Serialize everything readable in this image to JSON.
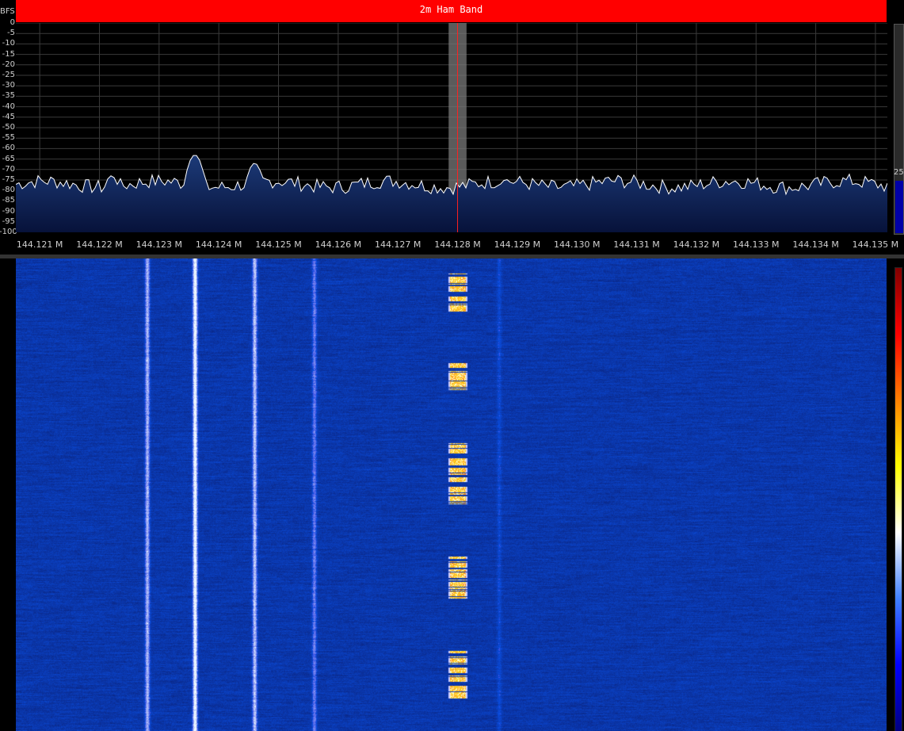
{
  "band": {
    "title": "2m Ham Band"
  },
  "spectrum": {
    "unit_label": "BFS",
    "db_ticks": [
      "0",
      "-5",
      "-10",
      "-15",
      "-20",
      "-25",
      "-30",
      "-35",
      "-40",
      "-45",
      "-50",
      "-55",
      "-60",
      "-65",
      "-70",
      "-75",
      "-80",
      "-85",
      "-90",
      "-95",
      "-100"
    ],
    "freq_ticks": [
      {
        "label": "144.121 M",
        "mhz": 144.121
      },
      {
        "label": "144.122 M",
        "mhz": 144.122
      },
      {
        "label": "144.123 M",
        "mhz": 144.123
      },
      {
        "label": "144.124 M",
        "mhz": 144.124
      },
      {
        "label": "144.125 M",
        "mhz": 144.125
      },
      {
        "label": "144.126 M",
        "mhz": 144.126
      },
      {
        "label": "144.127 M",
        "mhz": 144.127
      },
      {
        "label": "144.128 M",
        "mhz": 144.128
      },
      {
        "label": "144.129 M",
        "mhz": 144.129
      },
      {
        "label": "144.130 M",
        "mhz": 144.13
      },
      {
        "label": "144.131 M",
        "mhz": 144.131
      },
      {
        "label": "144.132 M",
        "mhz": 144.132
      },
      {
        "label": "144.133 M",
        "mhz": 144.133
      },
      {
        "label": "144.134 M",
        "mhz": 144.134
      },
      {
        "label": "144.135 M",
        "mhz": 144.135
      }
    ],
    "freq_range_mhz": [
      144.1206,
      144.1352
    ],
    "db_range": [
      -100,
      0
    ],
    "tuned_freq_mhz": 144.128,
    "filter_bandwidth_mhz": 0.0003,
    "noise_floor_db": -77,
    "peaks": [
      {
        "mhz": 144.1236,
        "db": -63
      },
      {
        "mhz": 144.1246,
        "db": -67
      },
      {
        "mhz": 144.1222,
        "db": -73
      },
      {
        "mhz": 144.1288,
        "db": -75
      }
    ],
    "right_level_value": "25",
    "right_level_fraction": 0.25,
    "colors": {
      "trace": "#ffffff",
      "fill_top": "#1c3a78",
      "fill_bottom": "#07123a",
      "grid": "#3a3a3a",
      "tuned_line": "#ff2020",
      "filter_band": "#7a7a7a"
    }
  },
  "waterfall": {
    "carriers": [
      {
        "mhz": 144.1228,
        "strength": 0.55
      },
      {
        "mhz": 144.1236,
        "strength": 0.85
      },
      {
        "mhz": 144.1246,
        "strength": 0.6
      },
      {
        "mhz": 144.1256,
        "strength": 0.35
      },
      {
        "mhz": 144.1287,
        "strength": 0.15
      }
    ],
    "bursts_fraction": [
      [
        0.03,
        0.12
      ],
      [
        0.22,
        0.28
      ],
      [
        0.39,
        0.52
      ],
      [
        0.63,
        0.72
      ],
      [
        0.83,
        0.93
      ]
    ],
    "burst_mhz": 144.128,
    "colorbar_colors": [
      "#000080",
      "#0000ff",
      "#4080ff",
      "#ffffff",
      "#ffff00",
      "#ff8000",
      "#ff0000",
      "#800000"
    ]
  }
}
